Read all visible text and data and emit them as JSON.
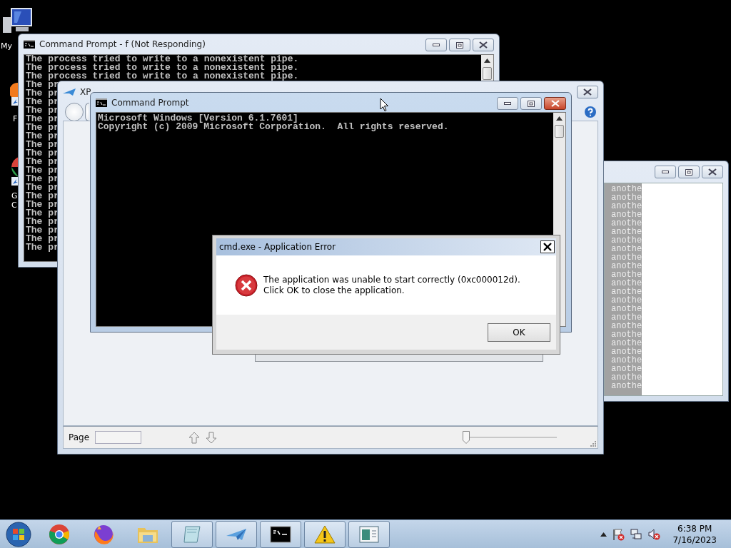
{
  "desktop_icons": [
    {
      "kind": "computer",
      "label_lines": [
        "My"
      ]
    },
    {
      "kind": "firefox",
      "label_lines": [
        "F"
      ]
    },
    {
      "kind": "chrome",
      "label_lines": [
        "G",
        "C"
      ]
    }
  ],
  "background_console": {
    "title": "Command Prompt - f (Not Responding)",
    "lines": [
      "The process tried to write to a nonexistent pipe.",
      "The process tried to write to a nonexistent pipe.",
      "The process tried to write to a nonexistent pipe.",
      "The pr",
      "The pr",
      "The pr",
      "The pr",
      "The pr",
      "The pr",
      "The pr",
      "The pr",
      "The pr",
      "The pr",
      "The pr",
      "The pr",
      "The pr",
      "The pr",
      "The pr",
      "The pr",
      "The pr",
      "The pr",
      "The pr",
      "The pr"
    ]
  },
  "side_window": {
    "lines": [
      "anothe",
      "anothe",
      "anothe",
      "anothe",
      "anothe",
      "anothe",
      "anothe",
      "anothe",
      "anothe",
      "anothe",
      "anothe",
      "anothe",
      "anothe",
      "anothe",
      "anothe",
      "anothe",
      "anothe",
      "anothe",
      "anothe",
      "anothe",
      "anothe",
      "anothe",
      "anothe",
      "anothe"
    ]
  },
  "document_viewer": {
    "title": "XP",
    "page_label": "Page",
    "zoom": {
      "level": 0
    }
  },
  "console": {
    "title": "Command Prompt",
    "lines": [
      "Microsoft Windows [Version 6.1.7601]",
      "Copyright (c) 2009 Microsoft Corporation.  All rights reserved."
    ]
  },
  "error_dialog": {
    "title": "cmd.exe - Application Error",
    "message": "The application was unable to start correctly (0xc000012d). Click OK to close the application.",
    "buttons": [
      "OK"
    ]
  },
  "taskbar": {
    "apps": [
      {
        "kind": "chrome",
        "open": false
      },
      {
        "kind": "firefox",
        "open": false
      },
      {
        "kind": "folder",
        "open": false
      },
      {
        "kind": "notepad",
        "open": true
      },
      {
        "kind": "plane",
        "open": true
      },
      {
        "kind": "console",
        "open": true
      },
      {
        "kind": "warning",
        "open": true
      },
      {
        "kind": "window",
        "open": true
      }
    ],
    "time": "6:38 PM",
    "date": "7/16/2023"
  }
}
